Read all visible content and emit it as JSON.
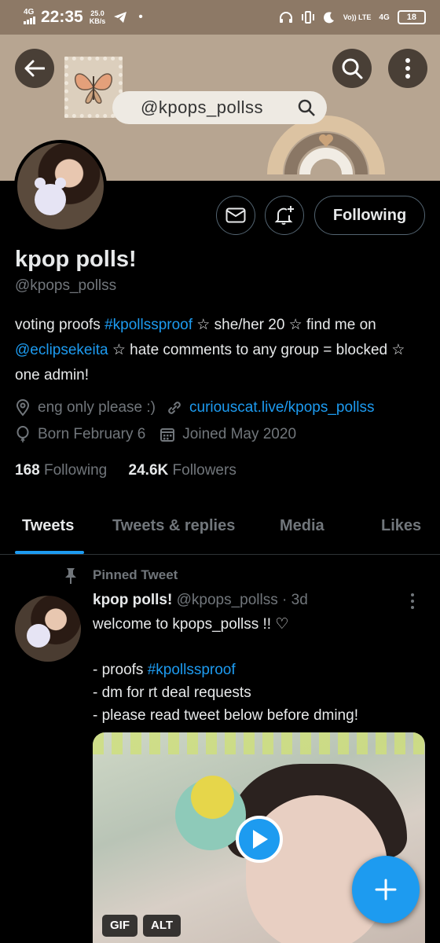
{
  "status_bar": {
    "network_top": "4G",
    "time": "22:35",
    "speed_value": "25.0",
    "speed_unit": "KB/s",
    "dot": "•",
    "volte": "Vo)) LTE",
    "network_right": "4G",
    "battery": "18"
  },
  "header": {
    "banner_handle": "@kpops_pollss",
    "banner_color": "#b7a591"
  },
  "profile": {
    "follow_label": "Following",
    "name": "kpop polls!",
    "handle": "@kpops_pollss",
    "bio": {
      "p1": "voting proofs ",
      "hashtag": "#kpollssproof",
      "p2": " ☆ she/her 20 ☆ find me on ",
      "mention": "@eclipsekeita",
      "p3": " ☆ hate comments to any group = blocked ☆ one admin!"
    },
    "location": "eng only please :)",
    "website": "curiouscat.live/kpops_pollss",
    "birthday": "Born February 6",
    "joined": "Joined May 2020",
    "following_count": "168",
    "following_label": "Following",
    "followers_count": "24.6K",
    "followers_label": "Followers"
  },
  "tabs": [
    {
      "label": "Tweets",
      "active": true
    },
    {
      "label": "Tweets & replies",
      "active": false
    },
    {
      "label": "Media",
      "active": false
    },
    {
      "label": "Likes",
      "active": false
    }
  ],
  "pinned_tweet": {
    "pinned_label": "Pinned Tweet",
    "author": "kpop polls!",
    "handle_time": "@kpops_pollss · 3d",
    "line1": "welcome to kpops_pollss !! ♡",
    "line2_prefix": "- proofs ",
    "line2_hashtag": "#kpollssproof",
    "line3": "- dm for rt deal requests",
    "line4": "- please read tweet below before dming!",
    "gif_badge": "GIF",
    "alt_badge": "ALT"
  },
  "colors": {
    "accent": "#1d9bf0",
    "background": "#000000",
    "secondary_text": "#71767b"
  }
}
